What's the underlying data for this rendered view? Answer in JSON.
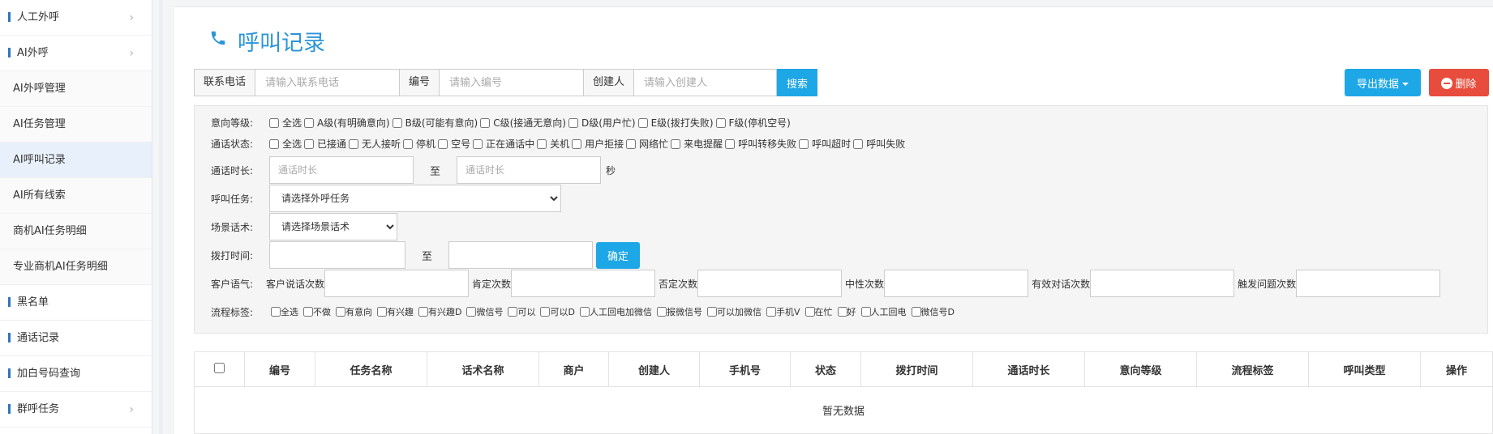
{
  "sidebar": {
    "items": [
      {
        "label": "人工外呼",
        "type": "top",
        "chevron": true
      },
      {
        "label": "AI外呼",
        "type": "top",
        "chevron": true
      },
      {
        "label": "AI外呼管理",
        "type": "sub"
      },
      {
        "label": "AI任务管理",
        "type": "sub"
      },
      {
        "label": "AI呼叫记录",
        "type": "sub",
        "active": true
      },
      {
        "label": "AI所有线索",
        "type": "sub"
      },
      {
        "label": "商机AI任务明细",
        "type": "sub"
      },
      {
        "label": "专业商机AI任务明细",
        "type": "sub"
      },
      {
        "label": "黑名单",
        "type": "top"
      },
      {
        "label": "通话记录",
        "type": "top"
      },
      {
        "label": "加白号码查询",
        "type": "top"
      },
      {
        "label": "群呼任务",
        "type": "top",
        "chevron": true
      }
    ]
  },
  "header": {
    "title": "呼叫记录",
    "icon": "phone-icon"
  },
  "search": {
    "phone_label": "联系电话",
    "phone_placeholder": "请输入联系电话",
    "id_label": "编号",
    "id_placeholder": "请输入编号",
    "creator_label": "创建人",
    "creator_placeholder": "请输入创建人",
    "search_button": "搜索"
  },
  "actions": {
    "export_label": "导出数据",
    "delete_label": "删除"
  },
  "filters": {
    "intent": {
      "label": "意向等级:",
      "options": [
        "全选",
        "A级(有明确意向)",
        "B级(可能有意向)",
        "C级(接通无意向)",
        "D级(用户忙)",
        "E级(拨打失败)",
        "F级(停机空号)"
      ]
    },
    "call_status": {
      "label": "通话状态:",
      "options": [
        "全选",
        "已接通",
        "无人接听",
        "停机",
        "空号",
        "正在通话中",
        "关机",
        "用户拒接",
        "网络忙",
        "来电提醒",
        "呼叫转移失败",
        "呼叫超时",
        "呼叫失败"
      ]
    },
    "duration": {
      "label": "通话时长:",
      "placeholder_from": "通话时长",
      "to": "至",
      "placeholder_to": "通话时长",
      "unit": "秒"
    },
    "task": {
      "label": "呼叫任务:",
      "selected": "请选择外呼任务"
    },
    "script": {
      "label": "场景话术:",
      "selected": "请选择场景话术"
    },
    "dial_time": {
      "label": "拨打时间:",
      "to": "至",
      "confirm": "确定"
    },
    "tone": {
      "label": "客户语气:",
      "fields": [
        "客户说话次数",
        "肯定次数",
        "否定次数",
        "中性次数",
        "有效对话次数",
        "触发问题次数"
      ]
    },
    "tags": {
      "label": "流程标签:",
      "options": [
        "全选",
        "不做",
        "有意向",
        "有兴趣",
        "有兴趣D",
        "微信号",
        "可以",
        "可以D",
        "人工回电加微信",
        "报微信号",
        "可以加微信",
        "手机V",
        "在忙",
        "好",
        "人工回电",
        "微信号D"
      ]
    }
  },
  "table": {
    "columns": [
      "编号",
      "任务名称",
      "话术名称",
      "商户",
      "创建人",
      "手机号",
      "状态",
      "拨打时间",
      "通话时长",
      "意向等级",
      "流程标签",
      "呼叫类型",
      "操作"
    ],
    "empty_text": "暂无数据"
  }
}
